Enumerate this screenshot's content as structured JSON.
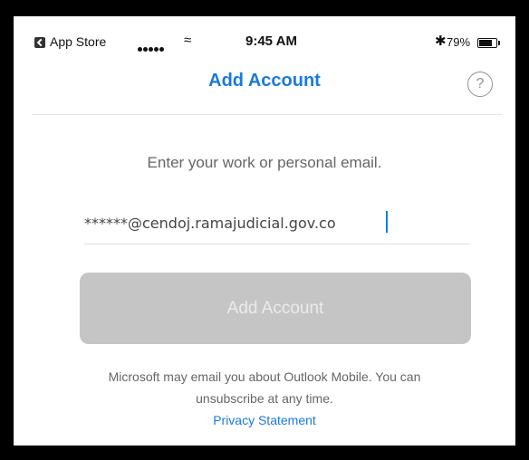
{
  "status_bar": {
    "back_app": "App Store",
    "signal_dots": 5,
    "time": "9:45 AM",
    "battery_pct": "79%",
    "battery_level": 0.79
  },
  "nav": {
    "title": "Add Account",
    "help_label": "?"
  },
  "form": {
    "prompt": "Enter your work or personal email.",
    "email_value": "******@cendoj.ramajudicial.gov.co",
    "button_label": "Add Account"
  },
  "footer": {
    "disclaimer": "Microsoft may email you about Outlook Mobile. You can unsubscribe at any time.",
    "privacy_link": "Privacy Statement"
  },
  "colors": {
    "accent": "#1c7ad8",
    "button_disabled_bg": "#c5c5c5",
    "button_disabled_text": "#ebebeb",
    "body_text": "#666666"
  },
  "icons": [
    "back-to-app-icon",
    "signal-dots-icon",
    "wifi-icon",
    "bluetooth-icon",
    "battery-icon",
    "help-icon"
  ]
}
